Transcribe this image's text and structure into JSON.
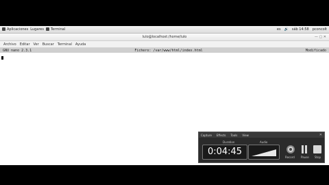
{
  "topbar": {
    "applications": "Aplicaciones",
    "places": "Lugares",
    "terminal": "Terminal",
    "lang": "es",
    "time": "sáb 14:58",
    "user": "pconcolt"
  },
  "window": {
    "title": "lulo@localhost:/home/lulo"
  },
  "menubar": {
    "items": [
      "Archivo",
      "Editar",
      "Ver",
      "Buscar",
      "Terminal",
      "Ayuda"
    ]
  },
  "nano": {
    "version": "GNU nano 2.3.1",
    "file": "Fichero: /var/www/html/index.html",
    "status": "Modificado"
  },
  "recorder": {
    "menu": [
      "Capture",
      "Effects",
      "Tools",
      "View"
    ],
    "duration_label": "Duration",
    "duration": "0:04:45",
    "audio_label": "Audio",
    "record_label": "Record",
    "pause_label": "Pause",
    "stop_label": "Stop"
  }
}
